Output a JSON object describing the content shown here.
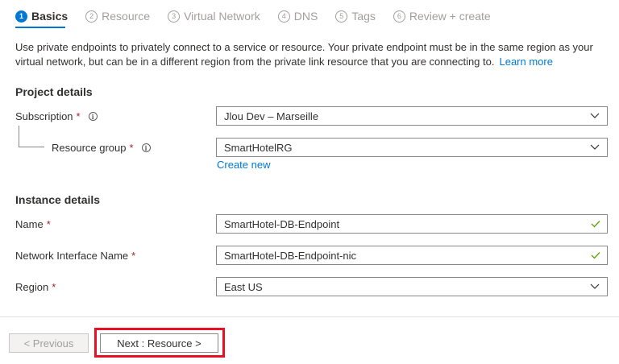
{
  "tabs": [
    {
      "num": "1",
      "label": "Basics"
    },
    {
      "num": "2",
      "label": "Resource"
    },
    {
      "num": "3",
      "label": "Virtual Network"
    },
    {
      "num": "4",
      "label": "DNS"
    },
    {
      "num": "5",
      "label": "Tags"
    },
    {
      "num": "6",
      "label": "Review + create"
    }
  ],
  "description": {
    "text": "Use private endpoints to privately connect to a service or resource. Your private endpoint must be in the same region as your virtual network, but can be in a different region from the private link resource that you are connecting to.",
    "link": "Learn more"
  },
  "project_details": {
    "title": "Project details",
    "subscription": {
      "label": "Subscription",
      "required": "*",
      "value": "Jlou Dev – Marseille"
    },
    "resource_group": {
      "label": "Resource group",
      "required": "*",
      "value": "SmartHotelRG",
      "create_new": "Create new"
    }
  },
  "instance_details": {
    "title": "Instance details",
    "name": {
      "label": "Name",
      "required": "*",
      "value": "SmartHotel-DB-Endpoint"
    },
    "nic_name": {
      "label": "Network Interface Name",
      "required": "*",
      "value": "SmartHotel-DB-Endpoint-nic"
    },
    "region": {
      "label": "Region",
      "required": "*",
      "value": "East US"
    }
  },
  "footer": {
    "previous_label": "< Previous",
    "next_label": "Next : Resource >"
  },
  "colors": {
    "accent": "#0078d4",
    "required": "#a4262c",
    "valid_check": "#57a300",
    "highlight": "#e81123"
  },
  "icons": {
    "info": "info-icon",
    "dropdown": "chevron-down-icon",
    "valid": "checkmark-icon"
  }
}
